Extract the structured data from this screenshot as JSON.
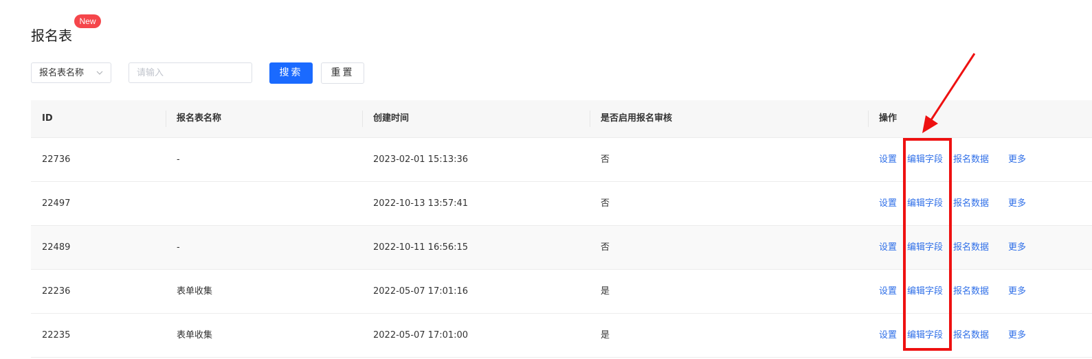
{
  "header": {
    "title": "报名表",
    "badge": "New"
  },
  "filters": {
    "field_select_value": "报名表名称",
    "search_placeholder": "请输入",
    "search_button": "搜索",
    "reset_button": "重置"
  },
  "table": {
    "columns": [
      "ID",
      "报名表名称",
      "创建时间",
      "是否启用报名审核",
      "操作"
    ],
    "actions": [
      "设置",
      "编辑字段",
      "报名数据",
      "更多"
    ],
    "rows": [
      {
        "id": "22736",
        "name": "-",
        "created": "2023-02-01 15:13:36",
        "review": "否"
      },
      {
        "id": "22497",
        "name": "",
        "created": "2022-10-13 13:57:41",
        "review": "否"
      },
      {
        "id": "22489",
        "name": "-",
        "created": "2022-10-11 16:56:15",
        "review": "否"
      },
      {
        "id": "22236",
        "name": "表单收集",
        "created": "2022-05-07 17:01:16",
        "review": "是"
      },
      {
        "id": "22235",
        "name": "表单收集",
        "created": "2022-05-07 17:01:00",
        "review": "是"
      }
    ]
  },
  "colors": {
    "primary": "#1a6aff",
    "link": "#2f6fe8",
    "badge": "#f5464b",
    "annotation": "#ee1111"
  }
}
